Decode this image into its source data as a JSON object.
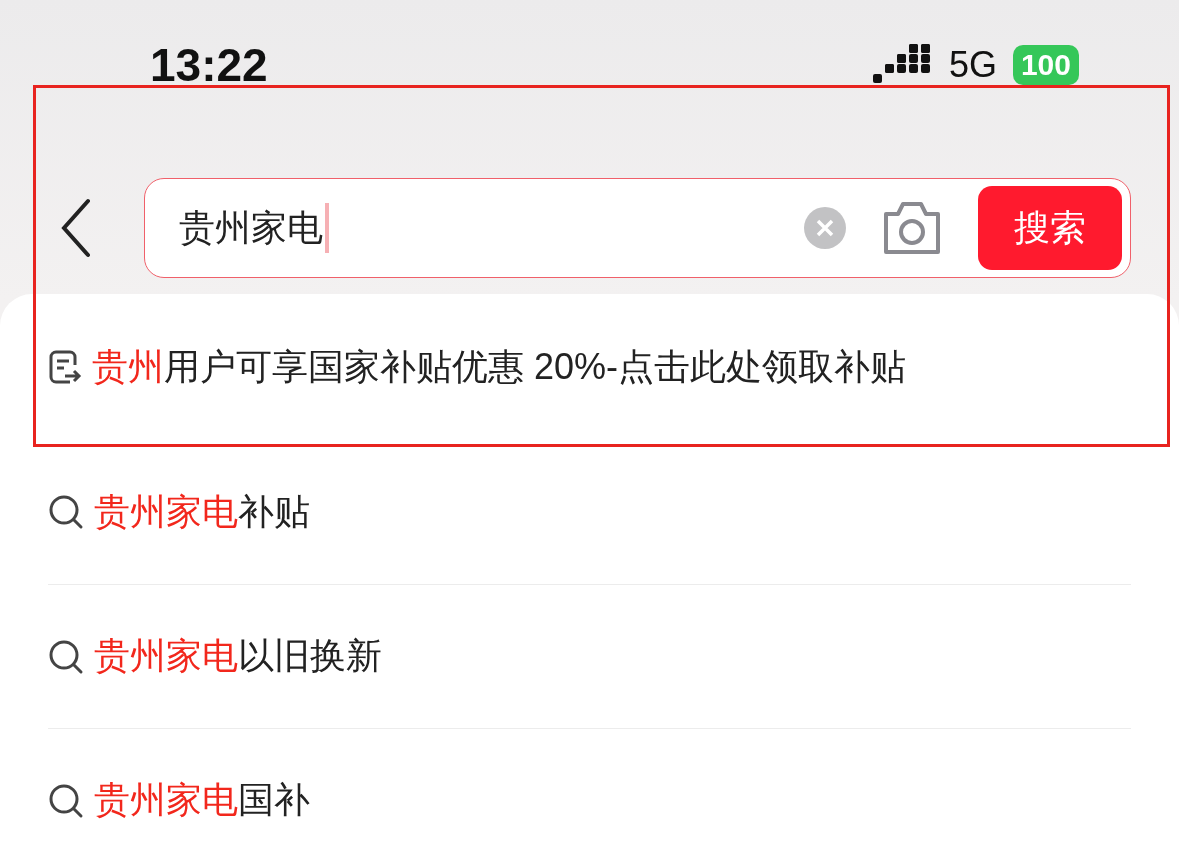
{
  "status_bar": {
    "time": "13:22",
    "network": "5G",
    "battery": "100"
  },
  "search": {
    "value": "贵州家电",
    "button": "搜索"
  },
  "suggestions": [
    {
      "kind": "promo",
      "highlight": "贵州",
      "text": "用户可享国家补贴优惠 20%-点击此处领取补贴"
    },
    {
      "kind": "query",
      "highlight": "贵州家电",
      "text": "补贴"
    },
    {
      "kind": "query",
      "highlight": "贵州家电",
      "text": "以旧换新"
    },
    {
      "kind": "query",
      "highlight": "贵州家电",
      "text": "国补"
    }
  ]
}
